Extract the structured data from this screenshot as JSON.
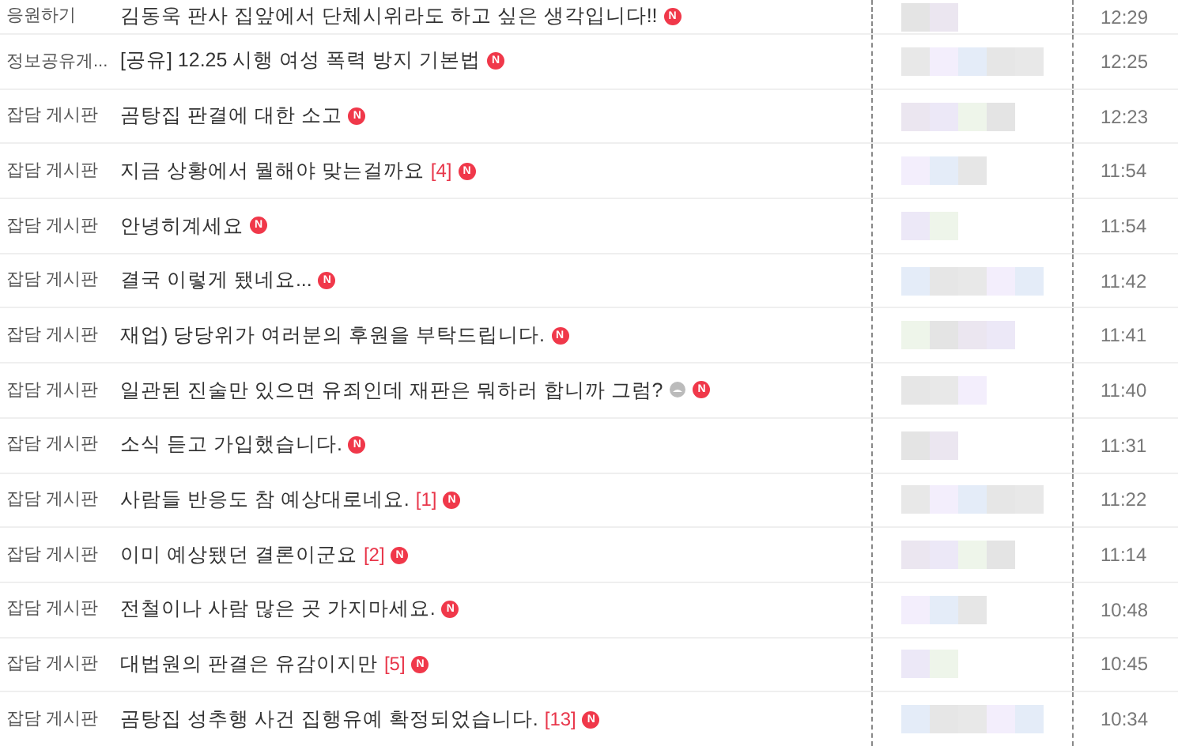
{
  "rows": [
    {
      "board": "응원하기",
      "title": "김동욱 판사 집앞에서 단체시위라도 하고 싶은 생각입니다!!",
      "badge": "N",
      "time": "12:29"
    },
    {
      "board": "정보공유게...",
      "title": "[공유] 12.25 시행 여성 폭력 방지 기본법",
      "badge": "N",
      "time": "12:25"
    },
    {
      "board": "잡담 게시판",
      "title": "곰탕집 판결에 대한 소고",
      "badge": "N",
      "time": "12:23"
    },
    {
      "board": "잡담 게시판",
      "title": "지금 상황에서 뭘해야 맞는걸까요",
      "comments": "[4]",
      "badge": "N",
      "time": "11:54"
    },
    {
      "board": "잡담 게시판",
      "title": "안녕히계세요",
      "badge": "N",
      "time": "11:54"
    },
    {
      "board": "잡담 게시판",
      "title": "결국 이렇게 됐네요...",
      "badge": "N",
      "time": "11:42"
    },
    {
      "board": "잡담 게시판",
      "title": "재업) 당당위가 여러분의 후원을 부탁드립니다.",
      "badge": "N",
      "time": "11:41"
    },
    {
      "board": "잡담 게시판",
      "title": "일관된 진술만 있으면 유죄인데 재판은 뭐하러 합니까 그럼?",
      "emoticon": true,
      "badge": "N",
      "time": "11:40"
    },
    {
      "board": "잡담 게시판",
      "title": "소식 듣고 가입했습니다.",
      "badge": "N",
      "time": "11:31"
    },
    {
      "board": "잡담 게시판",
      "title": "사람들 반응도 참 예상대로네요.",
      "comments": "[1]",
      "badge": "N",
      "time": "11:22"
    },
    {
      "board": "잡담 게시판",
      "title": "이미 예상됐던 결론이군요",
      "comments": "[2]",
      "badge": "N",
      "time": "11:14"
    },
    {
      "board": "잡담 게시판",
      "title": "전철이나 사람 많은 곳 가지마세요.",
      "badge": "N",
      "time": "10:48"
    },
    {
      "board": "잡담 게시판",
      "title": "대법원의 판결은 유감이지만",
      "comments": "[5]",
      "badge": "N",
      "time": "10:45"
    },
    {
      "board": "잡담 게시판",
      "title": "곰탕집 성추행 사건 집행유예 확정되었습니다.",
      "comments": "[13]",
      "badge": "N",
      "time": "10:34"
    }
  ]
}
